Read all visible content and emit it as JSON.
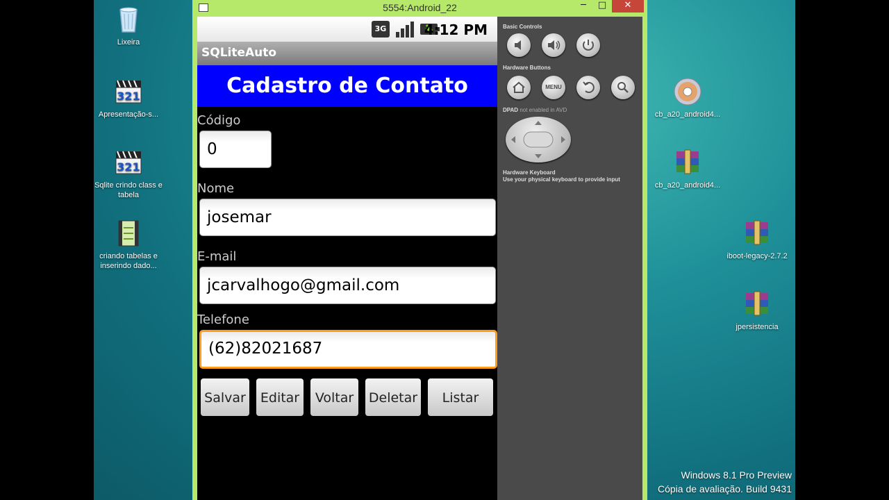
{
  "desktop": {
    "icons": [
      {
        "label": "Lixeira",
        "icon": "recycle-bin-icon"
      },
      {
        "label": "Apresentação-s...",
        "icon": "media-player-icon"
      },
      {
        "label": "Sqlite crindo class e tabela",
        "icon": "media-player-icon"
      },
      {
        "label": "criando tabelas e inserindo dado...",
        "icon": "video-file-icon"
      },
      {
        "label": "cb_a20_android4...",
        "icon": "disc-image-icon"
      },
      {
        "label": "cb_a20_android4...",
        "icon": "archive-icon"
      },
      {
        "label": "iboot-legacy-2.7.2",
        "icon": "archive-icon"
      },
      {
        "label": "jpersistencia",
        "icon": "archive-icon"
      }
    ],
    "watermark_line1": "Windows 8.1 Pro Preview",
    "watermark_line2": "Cópia de avaliação. Build 9431"
  },
  "window": {
    "title": "5554:Android_22",
    "minimize": "─",
    "maximize": "□",
    "close": "✕"
  },
  "status_bar": {
    "network": "3G",
    "time": "4:12 PM"
  },
  "app": {
    "title": "SQLiteAuto",
    "header": "Cadastro de Contato",
    "fields": [
      {
        "label": "Código",
        "value": "0"
      },
      {
        "label": "Nome",
        "value": "josemar"
      },
      {
        "label": "E-mail",
        "value": "jcarvalhogo@gmail.com"
      },
      {
        "label": "Telefone",
        "value": "(62)82021687"
      }
    ],
    "buttons": [
      "Salvar",
      "Editar",
      "Voltar",
      "Deletar",
      "Listar"
    ]
  },
  "controls": {
    "basic_label": "Basic Controls",
    "hardware_label": "Hardware Buttons",
    "menu_label": "MENU",
    "dpad_label": "DPAD",
    "dpad_note": "not enabled in AVD",
    "keyboard_label": "Hardware Keyboard",
    "keyboard_note": "Use your physical keyboard to provide input"
  },
  "colors": {
    "header_blue": "#0000ff",
    "focus_orange": "#ff9d1a",
    "window_frame": "#b6e86a"
  }
}
